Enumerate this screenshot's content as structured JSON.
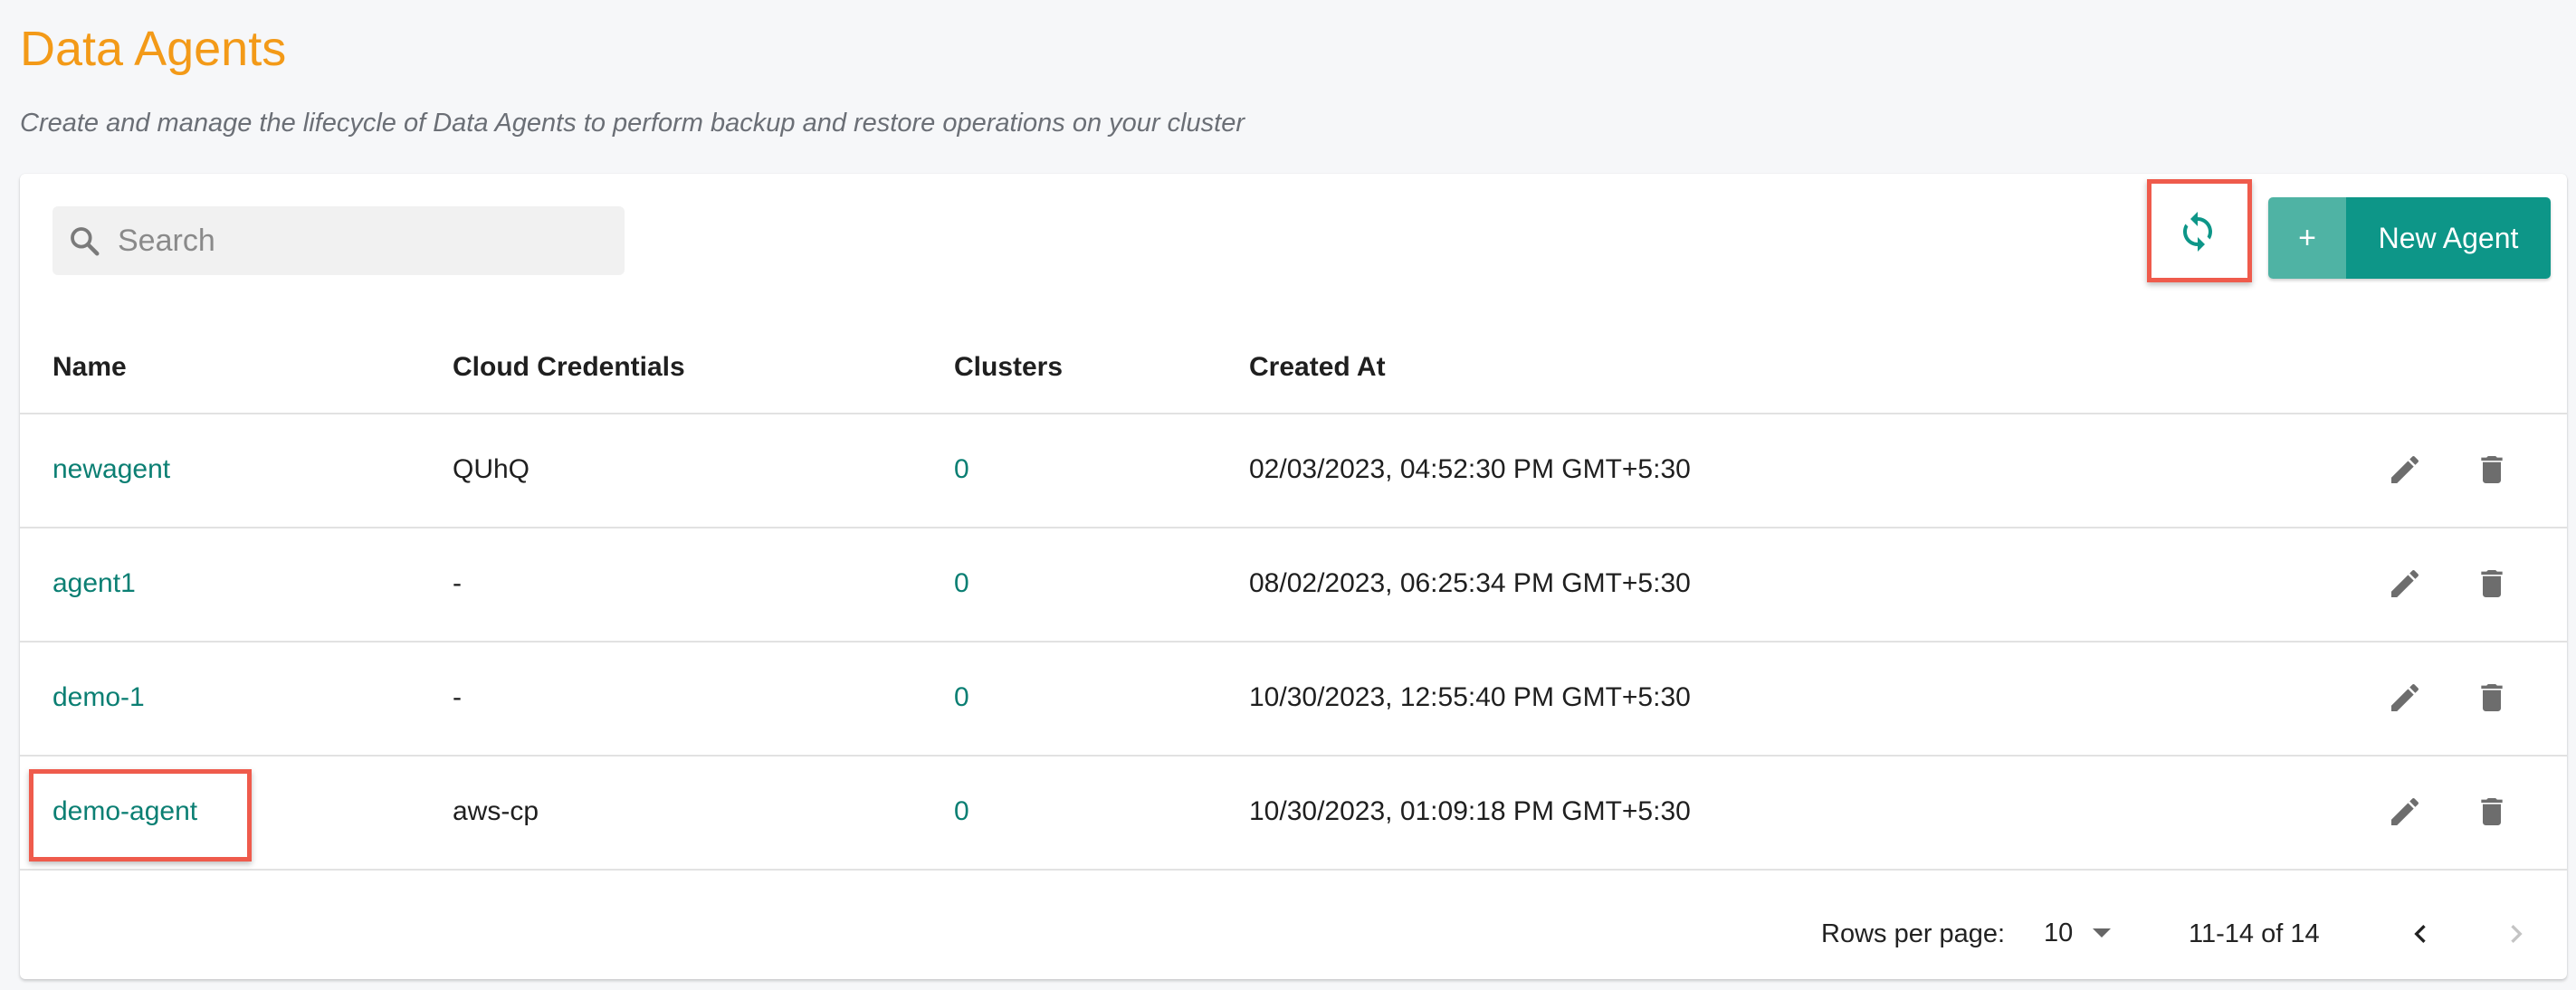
{
  "page": {
    "title": "Data Agents",
    "subtitle": "Create and manage the lifecycle of Data Agents to perform backup and restore operations on your cluster"
  },
  "toolbar": {
    "search_placeholder": "Search",
    "search_value": "",
    "refresh_icon": "refresh-icon",
    "new_agent_plus": "+",
    "new_agent_label": "New Agent"
  },
  "table": {
    "columns": {
      "name": "Name",
      "cloud_credentials": "Cloud Credentials",
      "clusters": "Clusters",
      "created_at": "Created At"
    },
    "rows": [
      {
        "name": "newagent",
        "cloud_credentials": "QUhQ",
        "clusters": "0",
        "created_at": "02/03/2023, 04:52:30 PM GMT+5:30"
      },
      {
        "name": "agent1",
        "cloud_credentials": "-",
        "clusters": "0",
        "created_at": "08/02/2023, 06:25:34 PM GMT+5:30"
      },
      {
        "name": "demo-1",
        "cloud_credentials": "-",
        "clusters": "0",
        "created_at": "10/30/2023, 12:55:40 PM GMT+5:30"
      },
      {
        "name": "demo-agent",
        "cloud_credentials": "aws-cp",
        "clusters": "0",
        "created_at": "10/30/2023, 01:09:18 PM GMT+5:30"
      }
    ],
    "row_actions": [
      "edit-icon",
      "delete-icon"
    ]
  },
  "pagination": {
    "rows_per_page_label": "Rows per page:",
    "rows_per_page_value": "10",
    "range_text": "11-14 of 14"
  },
  "colors": {
    "title": "#f39a18",
    "accent": "#0d9688",
    "accent_light": "#4fb3a4",
    "link": "#0b7f73",
    "highlight": "#ef5b4c"
  }
}
